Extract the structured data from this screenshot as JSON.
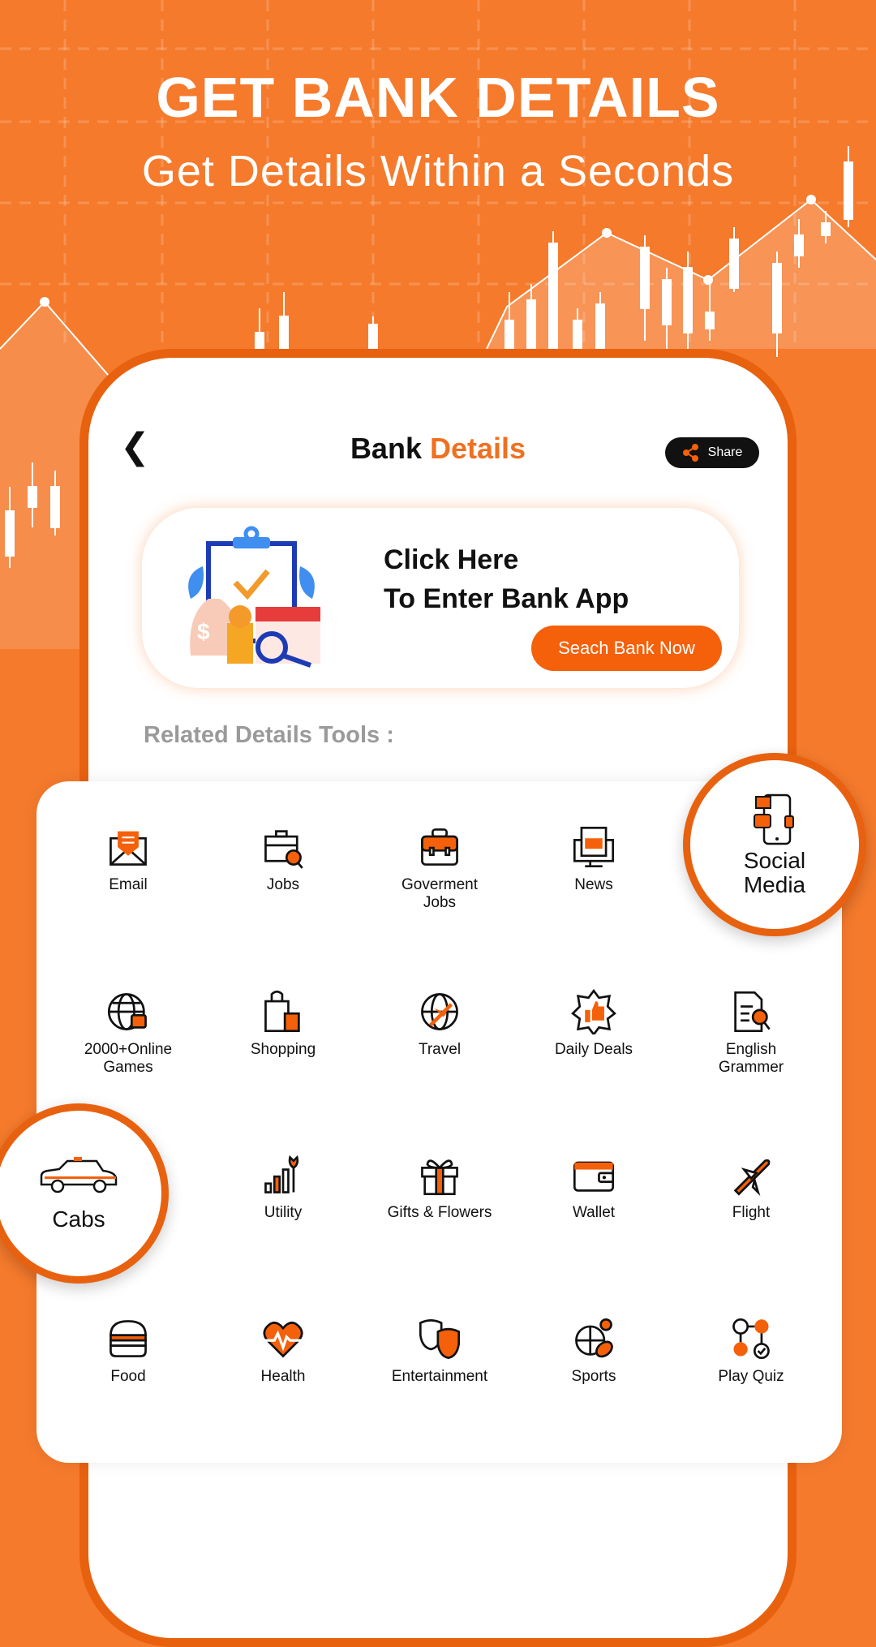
{
  "hero": {
    "title": "GET BANK DETAILS",
    "subtitle": "Get Details Within a Seconds"
  },
  "header": {
    "title_part1": "Bank",
    "title_part2": "Details",
    "share_label": "Share",
    "back_icon": "chevron-left-icon"
  },
  "banner": {
    "line1": "Click Here",
    "line2": "To Enter Bank App",
    "button": "Seach Bank Now"
  },
  "section_label": "Related Details Tools :",
  "tools": [
    {
      "label": "Email",
      "icon": "email-icon"
    },
    {
      "label": "Jobs",
      "icon": "job-search-icon"
    },
    {
      "label": "Goverment Jobs",
      "icon": "briefcase-icon"
    },
    {
      "label": "News",
      "icon": "news-icon"
    },
    {
      "label": "2000+Online Games",
      "icon": "globe-game-icon"
    },
    {
      "label": "Shopping",
      "icon": "shopping-bag-icon"
    },
    {
      "label": "Travel",
      "icon": "globe-plane-icon"
    },
    {
      "label": "Daily Deals",
      "icon": "thumbs-up-badge-icon"
    },
    {
      "label": "English Grammer",
      "icon": "document-search-icon"
    },
    {
      "label": "Utility",
      "icon": "wrench-bars-icon"
    },
    {
      "label": "Gifts & Flowers",
      "icon": "gift-icon"
    },
    {
      "label": "Wallet",
      "icon": "wallet-icon"
    },
    {
      "label": "Flight",
      "icon": "plane-icon"
    },
    {
      "label": "Food",
      "icon": "burger-icon"
    },
    {
      "label": "Health",
      "icon": "heart-pulse-icon"
    },
    {
      "label": "Entertainment",
      "icon": "theater-masks-icon"
    },
    {
      "label": "Sports",
      "icon": "sports-balls-icon"
    },
    {
      "label": "Play Quiz",
      "icon": "quiz-icon"
    }
  ],
  "featured": {
    "social": {
      "label": "Social Media",
      "icon": "social-media-phone-icon"
    },
    "cabs": {
      "label": "Cabs",
      "icon": "car-icon"
    }
  },
  "colors": {
    "background": "#f57a2c",
    "accent": "#f5600a",
    "frame": "#e8610f"
  }
}
